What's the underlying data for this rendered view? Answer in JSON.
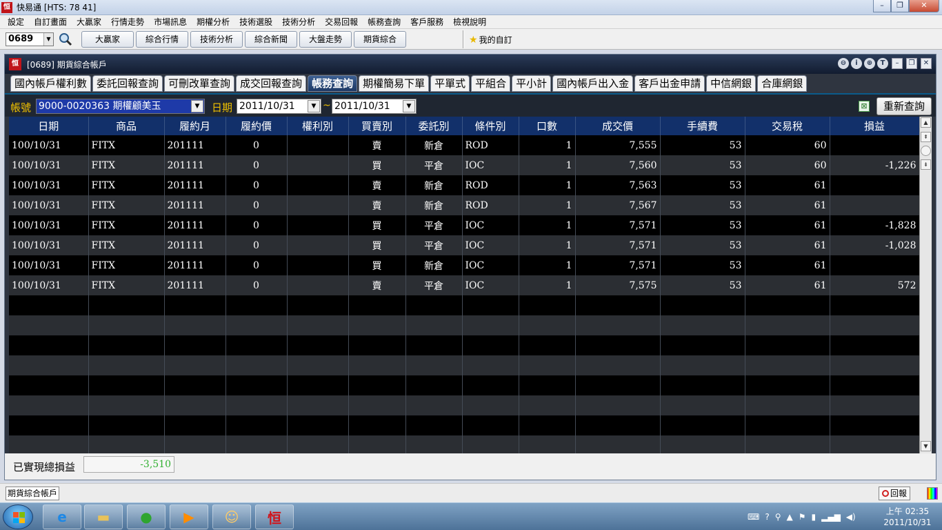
{
  "app": {
    "title": "快易通 [HTS: 78 41]",
    "icon_glyph": "恒"
  },
  "menu": [
    "設定",
    "自訂畫面",
    "大贏家",
    "行情走勢",
    "市場訊息",
    "期權分析",
    "技術選股",
    "技術分析",
    "交易回報",
    "帳務查詢",
    "客戶服務",
    "檢視說明"
  ],
  "toolbar": {
    "stock_code": "0689",
    "buttons": [
      "大贏家",
      "綜合行情",
      "技術分析",
      "綜合新聞",
      "大盤走勢",
      "期貨綜合"
    ],
    "favorites_label": "我的自訂"
  },
  "window": {
    "title": "[0689] 期貨綜合帳戶",
    "icon_glyph": "恒",
    "tool_glyphs": [
      "⊖",
      "i",
      "⊕",
      "T"
    ],
    "ctrl_glyphs": [
      "–",
      "❐",
      "✕"
    ]
  },
  "tabs": [
    {
      "label": "國內帳戶權利數",
      "active": false
    },
    {
      "label": "委託回報查詢",
      "active": false
    },
    {
      "label": "可刪改單查詢",
      "active": false
    },
    {
      "label": "成交回報查詢",
      "active": false
    },
    {
      "label": "帳務查詢",
      "active": true
    },
    {
      "label": "期權簡易下單",
      "active": false
    },
    {
      "label": "平單式",
      "active": false
    },
    {
      "label": "平組合",
      "active": false
    },
    {
      "label": "平小計",
      "active": false
    },
    {
      "label": "國內帳戶出入金",
      "active": false
    },
    {
      "label": "客戶出金申請",
      "active": false
    },
    {
      "label": "中信網銀",
      "active": false
    },
    {
      "label": "合庫網銀",
      "active": false
    }
  ],
  "query": {
    "account_label": "帳號",
    "account_value": "9000-0020363  期權顧美玉",
    "date_label": "日期",
    "date_from": "2011/10/31",
    "date_sep": "~",
    "date_to": "2011/10/31",
    "requery_label": "重新查詢"
  },
  "table": {
    "headers": [
      "日期",
      "商品",
      "履約月",
      "履約價",
      "權利別",
      "買賣別",
      "委託別",
      "條件別",
      "口數",
      "成交價",
      "手續費",
      "交易稅",
      "損益"
    ],
    "rows": [
      [
        "100/10/31",
        "FITX",
        "201111",
        "0",
        "",
        "賣",
        "新倉",
        "ROD",
        "1",
        "7,555",
        "53",
        "60",
        ""
      ],
      [
        "100/10/31",
        "FITX",
        "201111",
        "0",
        "",
        "買",
        "平倉",
        "IOC",
        "1",
        "7,560",
        "53",
        "60",
        "-1,226"
      ],
      [
        "100/10/31",
        "FITX",
        "201111",
        "0",
        "",
        "賣",
        "新倉",
        "ROD",
        "1",
        "7,563",
        "53",
        "61",
        ""
      ],
      [
        "100/10/31",
        "FITX",
        "201111",
        "0",
        "",
        "賣",
        "新倉",
        "ROD",
        "1",
        "7,567",
        "53",
        "61",
        ""
      ],
      [
        "100/10/31",
        "FITX",
        "201111",
        "0",
        "",
        "買",
        "平倉",
        "IOC",
        "1",
        "7,571",
        "53",
        "61",
        "-1,828"
      ],
      [
        "100/10/31",
        "FITX",
        "201111",
        "0",
        "",
        "買",
        "平倉",
        "IOC",
        "1",
        "7,571",
        "53",
        "61",
        "-1,028"
      ],
      [
        "100/10/31",
        "FITX",
        "201111",
        "0",
        "",
        "買",
        "新倉",
        "IOC",
        "1",
        "7,571",
        "53",
        "61",
        ""
      ],
      [
        "100/10/31",
        "FITX",
        "201111",
        "0",
        "",
        "賣",
        "平倉",
        "IOC",
        "1",
        "7,575",
        "53",
        "61",
        "572"
      ]
    ],
    "empty_rows": 8
  },
  "footer": {
    "realized_pnl_label": "已實現總損益",
    "realized_pnl_value": "-3,510"
  },
  "statusbar": {
    "window_item": "期貨綜合帳戶",
    "report_label": "回報"
  },
  "taskbar": {
    "clock_time": "上午 02:35",
    "clock_date": "2011/10/31"
  },
  "colors": {
    "buy": "#ff2020",
    "sell": "#1ed01e",
    "loss": "#30c030",
    "profit": "#ff3030",
    "header_bg": "#12306a",
    "label_yellow": "#f0c000"
  }
}
